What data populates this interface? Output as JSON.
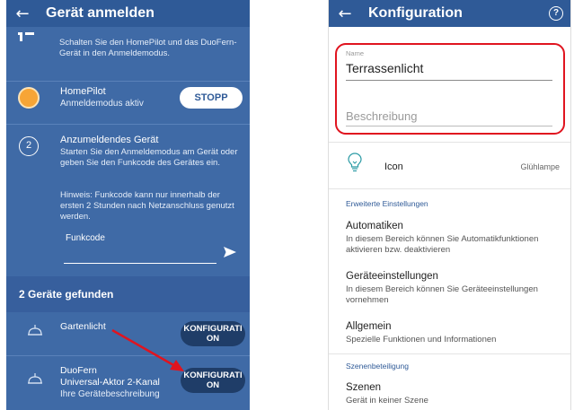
{
  "left": {
    "title": "Gerät anmelden",
    "intro_text": "Schalten Sie den HomePilot und das DuoFern-Gerät in den Anmeldemodus.",
    "homepilot": {
      "name": "HomePilot",
      "status": "Anmeldemodus aktiv",
      "stop_label": "STOPP",
      "status_color": "#f7a536"
    },
    "step": {
      "number": "2",
      "title": "Anzumeldendes Gerät",
      "description": "Starten Sie den Anmeldemodus am Gerät oder geben Sie den Funkcode des Gerätes ein.",
      "hint": "Hinweis: Funkcode kann nur innerhalb der ersten 2 Stunden nach Netzanschluss genutzt werden."
    },
    "funkcode": {
      "label": "Funkcode",
      "value": ""
    },
    "found_title": "2 Geräte gefunden",
    "devices": [
      {
        "name": "Gartenlicht",
        "button_line1": "KONFIGURATI",
        "button_line2": "ON"
      },
      {
        "name": "DuoFern",
        "name2": "Universal-Aktor 2-Kanal",
        "description": "Ihre Gerätebeschreibung",
        "button_line1": "KONFIGURATI",
        "button_line2": "ON"
      }
    ],
    "arrow_color": "#e0141f"
  },
  "right": {
    "title": "Konfiguration",
    "help_glyph": "?",
    "name_label": "Name",
    "name_value": "Terrassenlicht",
    "description_placeholder": "Beschreibung",
    "icon_label": "Icon",
    "icon_value": "Glühlampe",
    "sections": [
      {
        "header": "Erweiterte Einstellungen",
        "items": [
          {
            "title": "Automatiken",
            "description": "In diesem Bereich können Sie Automatikfunktionen aktivieren bzw. deaktivieren"
          },
          {
            "title": "Geräteeinstellungen",
            "description": "In diesem Bereich können Sie Geräteeinstellungen vornehmen"
          },
          {
            "title": "Allgemein",
            "description": "Spezielle Funktionen und Informationen"
          }
        ]
      },
      {
        "header": "Szenenbeteiligung",
        "items": [
          {
            "title": "Szenen",
            "description": "Gerät in keiner Szene"
          }
        ]
      }
    ],
    "highlight_color": "#e0141f"
  },
  "colors": {
    "primary": "#2f5a97",
    "background_blue": "#3f6aa6",
    "dark_button": "#1f3d68"
  }
}
